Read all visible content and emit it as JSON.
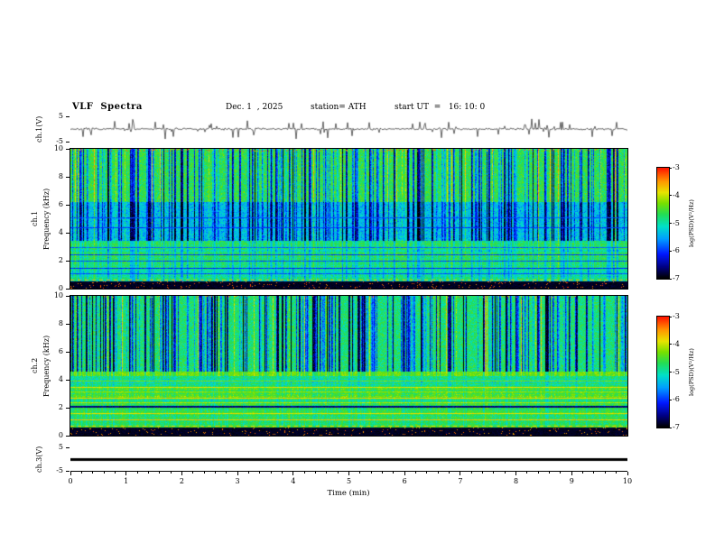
{
  "header": {
    "title": "VLF  Spectra",
    "date": "Dec. 1  , 2025",
    "station": "station= ATH",
    "start_ut": "start UT  =   16: 10: 0"
  },
  "xaxis": {
    "label": "Time  (min)",
    "range": [
      0,
      10
    ],
    "ticks": [
      0,
      1,
      2,
      3,
      4,
      5,
      6,
      7,
      8,
      9,
      10
    ]
  },
  "colormap": {
    "label": "log(PSD)(V²/Hz)",
    "zlim": [
      -7,
      -3
    ],
    "ticks": [
      -3,
      -4,
      -5,
      -6,
      -7
    ],
    "stops": [
      [
        0.0,
        "#000000"
      ],
      [
        0.1,
        "#000080"
      ],
      [
        0.22,
        "#0018ff"
      ],
      [
        0.36,
        "#00a0ff"
      ],
      [
        0.47,
        "#00e0c8"
      ],
      [
        0.58,
        "#22dd55"
      ],
      [
        0.68,
        "#77e000"
      ],
      [
        0.78,
        "#e8e400"
      ],
      [
        0.88,
        "#ff9800"
      ],
      [
        1.0,
        "#ff1500"
      ]
    ]
  },
  "chart_data": [
    {
      "type": "line",
      "name": "ch1-time-series",
      "ylabel": "ch.1(V)",
      "ylim": [
        -5,
        5
      ],
      "yticks": [
        5,
        -5
      ],
      "xlim": [
        0,
        10
      ],
      "series_desc": "broadband noise around 0 V with frequent impulsive spikes reaching about ±4 V",
      "noise": {
        "seed": 7,
        "sigma": 0.38,
        "spike_prob": 0.11,
        "spike_max": 4.0
      }
    },
    {
      "type": "heatmap",
      "name": "ch1-spectrogram",
      "ylabel": "ch.1 Frequency (kHz)",
      "ylabel_channel": "ch.1",
      "ylabel_axis": "Frequency (kHz)",
      "ylim": [
        0,
        10
      ],
      "yticks": [
        0,
        2,
        4,
        6,
        8,
        10
      ],
      "xlim": [
        0,
        10
      ],
      "zlim": [
        -7,
        -3
      ],
      "seed": 21,
      "streak_prob": 0.3,
      "bright_prob": 0.05,
      "bands": [
        {
          "f": [
            6.2,
            10.01
          ],
          "base": -4.65,
          "sigma": 0.5,
          "streak": 1.0
        },
        {
          "f": [
            3.4,
            6.2
          ],
          "base": -5.35,
          "sigma": 0.55,
          "streak": 0.9
        },
        {
          "f": [
            0.5,
            3.4
          ],
          "base": -4.85,
          "sigma": 0.4,
          "streak": 0.35,
          "row_amp": 0.3
        },
        {
          "f": [
            0,
            0.5
          ],
          "base": -6.9,
          "sigma": 0.12,
          "streak": 0,
          "speckle": {
            "prob": 0.045,
            "v": -3.3
          }
        }
      ],
      "top_speckle": {
        "f": 9.8,
        "prob": 0.1,
        "v": -3.3
      },
      "hlines": [
        {
          "f": 0.62,
          "v": -3.7,
          "dash": true
        },
        {
          "f": 1.05,
          "v": -5.9
        },
        {
          "f": 1.45,
          "v": -6.1
        },
        {
          "f": 1.95,
          "v": -5.9
        },
        {
          "f": 2.45,
          "v": -6.0
        },
        {
          "f": 2.95,
          "v": -5.8
        },
        {
          "f": 4.35,
          "v": -6.0
        },
        {
          "f": 5.05,
          "v": -5.9
        }
      ]
    },
    {
      "type": "heatmap",
      "name": "ch2-spectrogram",
      "ylabel": "ch.2 Frequency (kHz)",
      "ylabel_channel": "ch.2",
      "ylabel_axis": "Frequency (kHz)",
      "ylim": [
        0,
        10
      ],
      "yticks": [
        0,
        2,
        4,
        6,
        8,
        10
      ],
      "xlim": [
        0,
        10
      ],
      "zlim": [
        -7,
        -3
      ],
      "seed": 99,
      "streak_prob": 0.34,
      "bright_prob": 0.04,
      "bands": [
        {
          "f": [
            4.6,
            10.01
          ],
          "base": -4.8,
          "sigma": 0.5,
          "streak": 1.05
        },
        {
          "f": [
            4.25,
            4.6
          ],
          "base": -4.3,
          "sigma": 0.35,
          "streak": 0.3
        },
        {
          "f": [
            0.55,
            4.25
          ],
          "base": -4.7,
          "sigma": 0.4,
          "streak": 0.18,
          "row_amp": 0.5
        },
        {
          "f": [
            0,
            0.55
          ],
          "base": -6.9,
          "sigma": 0.12,
          "streak": 0,
          "speckle": {
            "prob": 0.04,
            "v": -3.4
          }
        }
      ],
      "top_speckle": {
        "f": 9.85,
        "prob": 0.06,
        "v": -3.4
      },
      "hlines": [
        {
          "f": 0.68,
          "v": -3.8,
          "dash": true
        },
        {
          "f": 1.1,
          "v": -3.7
        },
        {
          "f": 1.6,
          "v": -3.9
        },
        {
          "f": 2.05,
          "v": -6.6,
          "th": 2
        },
        {
          "f": 2.35,
          "v": -4.1
        },
        {
          "f": 2.7,
          "v": -3.8
        },
        {
          "f": 3.1,
          "v": -4.2
        },
        {
          "f": 3.45,
          "v": -3.9
        },
        {
          "f": 3.9,
          "v": -4.3
        }
      ]
    },
    {
      "type": "line",
      "name": "ch3-time-series",
      "ylabel": "ch.3(V)",
      "ylim": [
        -5,
        5
      ],
      "yticks": [
        5,
        -5
      ],
      "xlim": [
        0,
        10
      ],
      "series_desc": "constant flat line at 0 V",
      "constant_value": 0
    }
  ]
}
